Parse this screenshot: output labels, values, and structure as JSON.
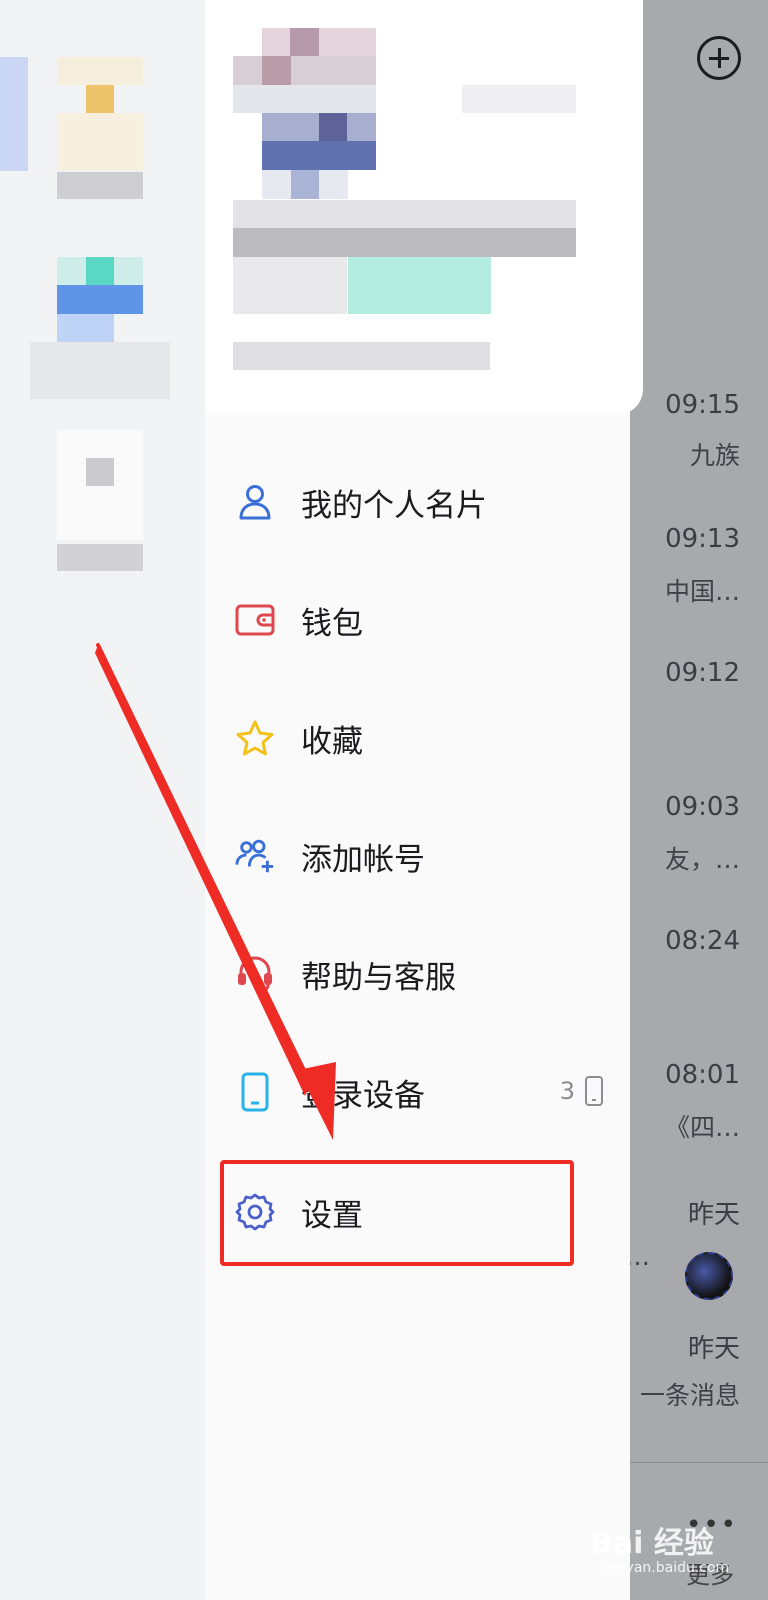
{
  "header": {
    "add_icon": "plus-circle-icon"
  },
  "drawer": {
    "menu": [
      {
        "id": "profile-card",
        "label": "我的个人名片",
        "icon": "person-icon",
        "color": "#3b6fd8"
      },
      {
        "id": "wallet",
        "label": "钱包",
        "icon": "wallet-icon",
        "color": "#e0484f"
      },
      {
        "id": "favorites",
        "label": "收藏",
        "icon": "star-icon",
        "color": "#f2c21b"
      },
      {
        "id": "add-account",
        "label": "添加帐号",
        "icon": "add-user-icon",
        "color": "#3b6fd8"
      },
      {
        "id": "help",
        "label": "帮助与客服",
        "icon": "headset-icon",
        "color": "#e0484f"
      },
      {
        "id": "devices",
        "label": "登录设备",
        "icon": "phone-icon",
        "color": "#29b2e8",
        "badge": "3"
      },
      {
        "id": "settings",
        "label": "设置",
        "icon": "gear-icon",
        "color": "#4a5fc9"
      }
    ]
  },
  "chat_list": {
    "rows": [
      {
        "time": "09:15",
        "snippet": "九族"
      },
      {
        "time": "09:13",
        "snippet": "中国…"
      },
      {
        "time": "09:12",
        "snippet": ""
      },
      {
        "time": "09:03",
        "snippet": "友，…"
      },
      {
        "time": "08:24",
        "snippet": ""
      },
      {
        "time": "08:01",
        "snippet": "《四…"
      },
      {
        "time": "昨天",
        "snippet": "…"
      },
      {
        "time": "昨天",
        "snippet": "一条消息"
      }
    ],
    "more_label": "更多"
  },
  "watermark": {
    "text": "Bai 经验",
    "sub": "jingyan.baidu.com"
  },
  "colors": {
    "highlight": "#ee2b25",
    "accent_blue": "#3b6fd8"
  }
}
